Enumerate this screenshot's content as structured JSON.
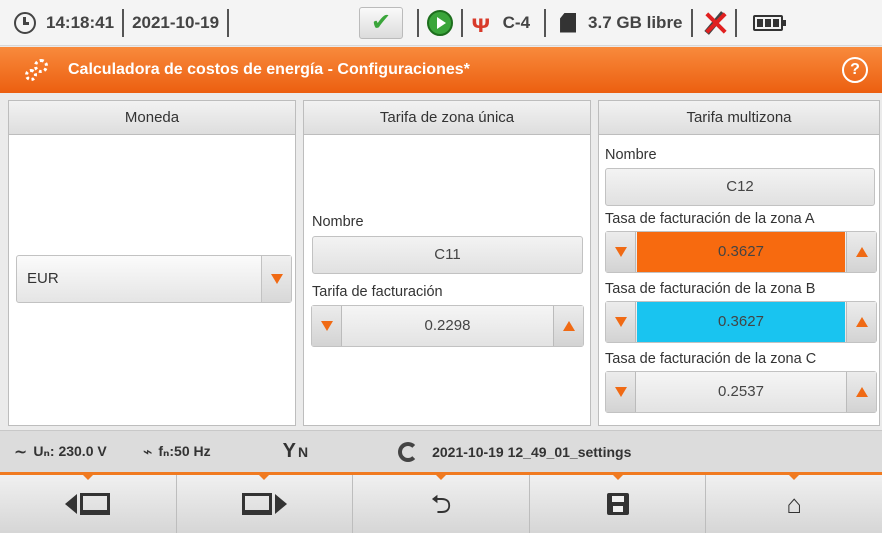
{
  "status": {
    "time": "14:18:41",
    "date": "2021-10-19",
    "clamp": "C-4",
    "storage": "3.7 GB libre"
  },
  "title": "Calculadora de costos de energía - Configuraciones*",
  "help": "?",
  "currency": {
    "header": "Moneda",
    "value": "EUR"
  },
  "single": {
    "header": "Tarifa de zona única",
    "name_label": "Nombre",
    "name_value": "C11",
    "rate_label": "Tarifa de facturación",
    "rate_value": "0.2298"
  },
  "multi": {
    "header": "Tarifa multizona",
    "name_label": "Nombre",
    "name_value": "C12",
    "zones": [
      {
        "label": "Tasa de facturación de la zona A",
        "value": "0.3627",
        "color": "#f76a0f"
      },
      {
        "label": "Tasa de facturación de la zona B",
        "value": "0.3627",
        "color": "#19c4f0"
      },
      {
        "label": "Tasa de facturación de la zona C",
        "value": "0.2537",
        "color": "#ebebeb"
      }
    ]
  },
  "info": {
    "voltage": "Uₙ: 230.0 V",
    "freq": "fₙ:50 Hz",
    "phase": "N",
    "settings_file": "2021-10-19 12_49_01_settings"
  },
  "colors": {
    "accent": "#f06a14",
    "zone_a": "#f76a0f",
    "zone_b": "#19c4f0"
  }
}
